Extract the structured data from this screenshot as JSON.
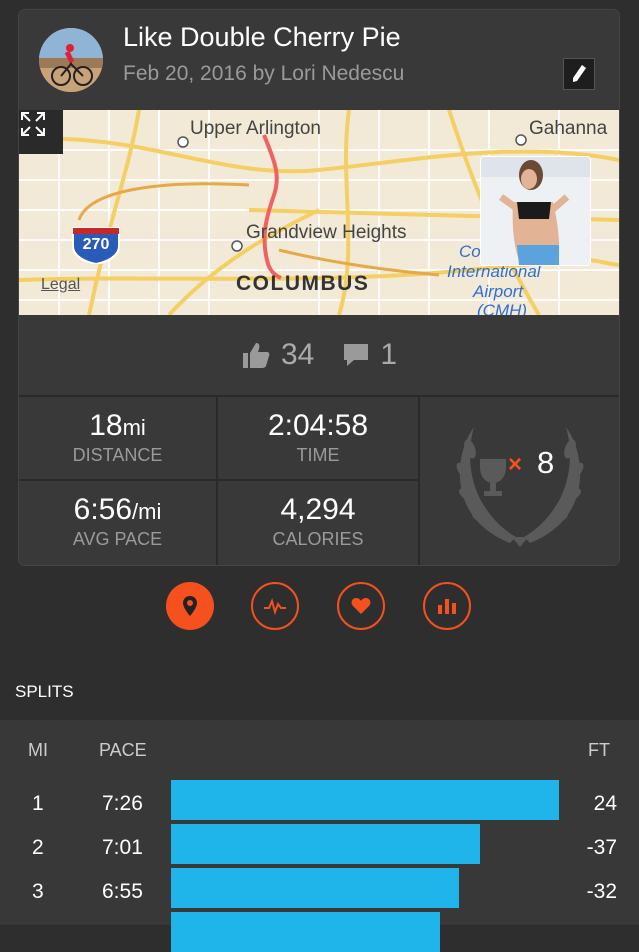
{
  "activity": {
    "title": "Like Double Cherry Pie",
    "subtitle": "Feb 20, 2016 by Lori Nedescu"
  },
  "map": {
    "labels": {
      "upper_arlington": "Upper Arlington",
      "gahanna": "Gahanna",
      "grandview": "Grandview Heights",
      "columbus": "COLUMBUS",
      "airport_1": "Co",
      "airport_2": "International",
      "airport_3": "Airport",
      "airport_4": "(CMH)",
      "legal": "Legal",
      "highway": "270"
    }
  },
  "social": {
    "likes": "34",
    "comments": "1"
  },
  "stats": {
    "distance_value": "18",
    "distance_unit": "mi",
    "distance_label": "DISTANCE",
    "time_value": "2:04:58",
    "time_label": "TIME",
    "pace_value": "6:56",
    "pace_unit": "/mi",
    "pace_label": "AVG PACE",
    "calories_value": "4,294",
    "calories_label": "CALORIES",
    "trophy_multiplier": "×",
    "trophy_count": "8"
  },
  "colors": {
    "accent": "#f4511e",
    "bar": "#1fb4ea"
  },
  "splits": {
    "title": "SPLITS",
    "headers": {
      "mi": "MI",
      "pace": "PACE",
      "ft": "FT"
    },
    "rows": [
      {
        "mi": "1",
        "pace": "7:26",
        "ft": "24",
        "fraction": 1.0
      },
      {
        "mi": "2",
        "pace": "7:01",
        "ft": "-37",
        "fraction": 0.796
      },
      {
        "mi": "3",
        "pace": "6:55",
        "ft": "-32",
        "fraction": 0.742
      },
      {
        "mi": "",
        "pace": "",
        "ft": "",
        "fraction": 0.694
      }
    ]
  }
}
